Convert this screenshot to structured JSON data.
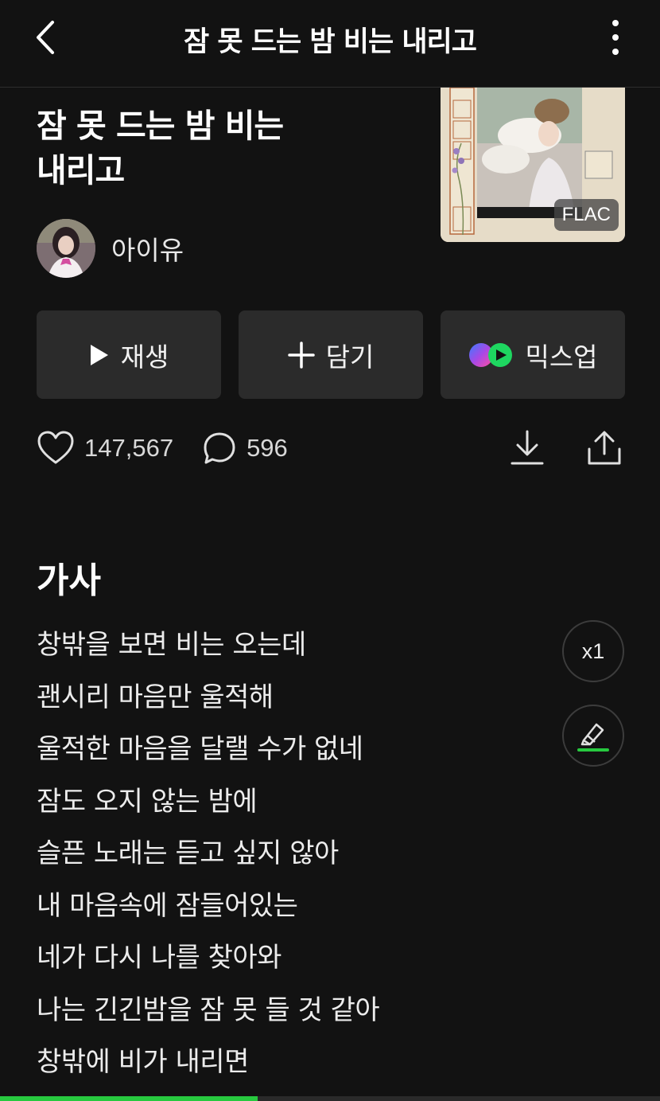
{
  "header": {
    "title": "잠 못 드는 밤 비는 내리고",
    "back_icon": "chevron-left-icon",
    "more_icon": "more-vertical-icon"
  },
  "song": {
    "title_line1": "잠 못 드는 밤 비는",
    "title_line2": "내리고",
    "artist": "아이유",
    "quality_badge": "FLAC"
  },
  "actions": {
    "play_label": "재생",
    "add_label": "담기",
    "mixup_label": "믹스업"
  },
  "stats": {
    "likes": "147,567",
    "comments": "596"
  },
  "lyrics": {
    "heading": "가사",
    "lines": [
      "창밖을 보면 비는 오는데",
      "괜시리 마음만 울적해",
      "울적한 마음을 달랠 수가 없네",
      "잠도 오지 않는 밤에",
      "슬픈 노래는 듣고 싶지 않아",
      "내 마음속에 잠들어있는",
      "네가 다시 나를 찾아와",
      "나는 긴긴밤을 잠 못 들 것 같아",
      "창밖에 비가 내리면"
    ],
    "speed_label": "x1"
  },
  "player": {
    "progress": 0.39
  },
  "colors": {
    "background": "#121212",
    "button_bg": "#2b2b2b",
    "accent_green": "#27c93f"
  }
}
